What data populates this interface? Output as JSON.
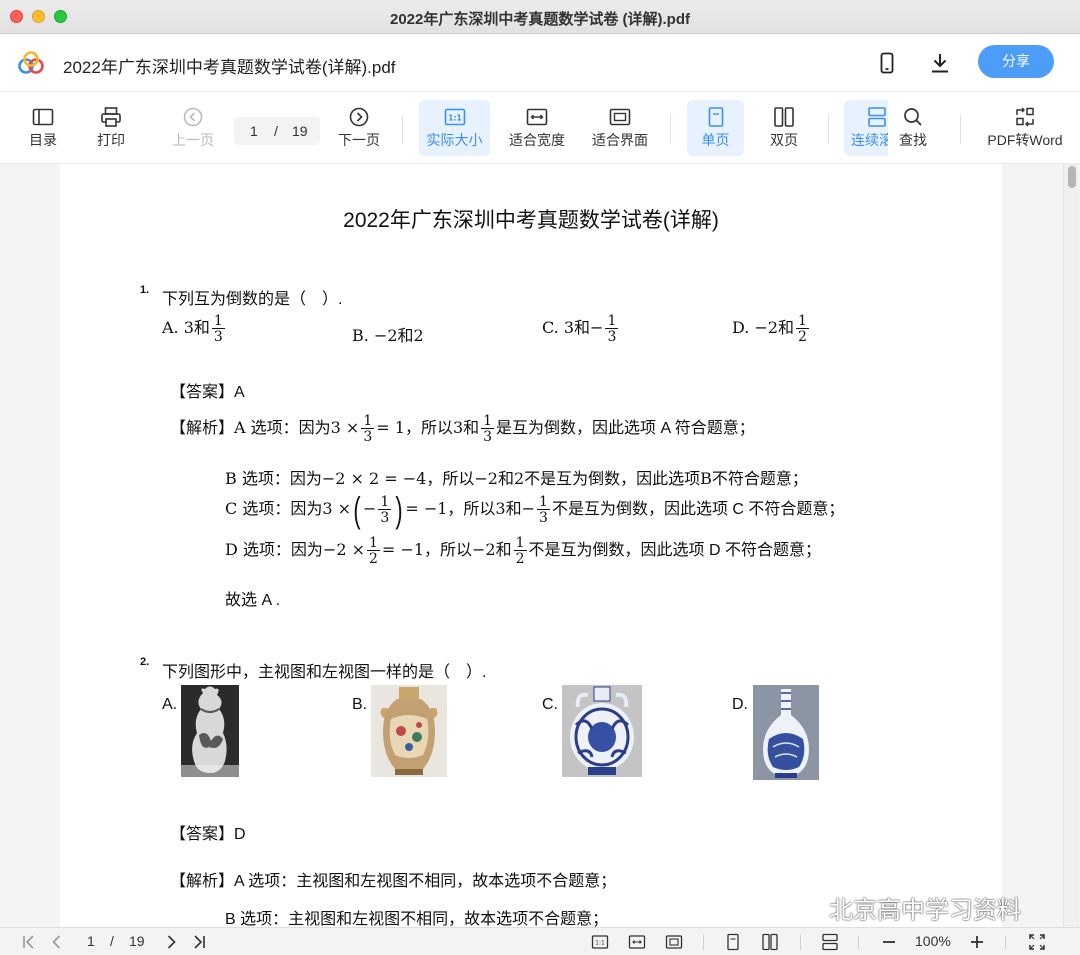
{
  "window": {
    "title": "2022年广东深圳中考真题数学试卷 (详解).pdf"
  },
  "header": {
    "doc_title": "2022年广东深圳中考真题数学试卷(详解).pdf",
    "share_label": "分享"
  },
  "toolbar": {
    "toc": "目录",
    "print": "打印",
    "prev": "上一页",
    "page_current": "1",
    "page_sep": "/",
    "page_total": "19",
    "next": "下一页",
    "actual_size": "实际大小",
    "fit_width": "适合宽度",
    "fit_screen": "适合界面",
    "single_page": "单页",
    "double_page": "双页",
    "continuous": "连续滚",
    "search": "查找",
    "pdf_to_word": "PDF转Word"
  },
  "document": {
    "title": "2022年广东深圳中考真题数学试卷(详解)",
    "q1": {
      "num": "1.",
      "stem": "下列互为倒数的是（　）.",
      "opt_a_pre": "A. 3和",
      "opt_b": "B. −2和2",
      "opt_c_pre": "C. 3和−",
      "opt_d_pre": "D. −2和",
      "answer": "【答案】A",
      "ana_label": "【解析】",
      "ana_a1": "A 选项：因为3 ×",
      "ana_a2": "= 1，所以3和",
      "ana_a3": "是互为倒数，因此选项 A 符合题意；",
      "ana_b": "B 选项：因为−2 × 2 = −4，所以−2和2不是互为倒数，因此选项B不符合题意；",
      "ana_c1": "C 选项：因为3 ×",
      "ana_c2": "= −1，所以3和−",
      "ana_c3": "不是互为倒数，因此选项 C 不符合题意；",
      "ana_d1": "D 选项：因为−2 ×",
      "ana_d2": "= −1，所以−2和",
      "ana_d3": "不是互为倒数，因此选项 D 不符合题意；",
      "conclusion": "故选 A ."
    },
    "q2": {
      "num": "2.",
      "stem": "下列图形中，主视图和左视图一样的是（　）.",
      "opt_a": "A.",
      "opt_b": "B.",
      "opt_c": "C.",
      "opt_d": "D.",
      "answer": "【答案】D",
      "ana_label": "【解析】",
      "ana_a": "A 选项：主视图和左视图不相同，故本选项不合题意；",
      "ana_b": "B 选项：主视图和左视图不相同，故本选项不合题意；"
    },
    "fractions": {
      "one": "1",
      "two": "2",
      "three": "3",
      "minus": "−"
    }
  },
  "statusbar": {
    "page_current": "1",
    "page_sep": "/",
    "page_total": "19",
    "zoom": "100%"
  },
  "watermark": "北京高中学习资料",
  "colors": {
    "accent": "#4b9df8",
    "active_bg": "#e8f2fe",
    "active_text": "#3a8ff0"
  }
}
